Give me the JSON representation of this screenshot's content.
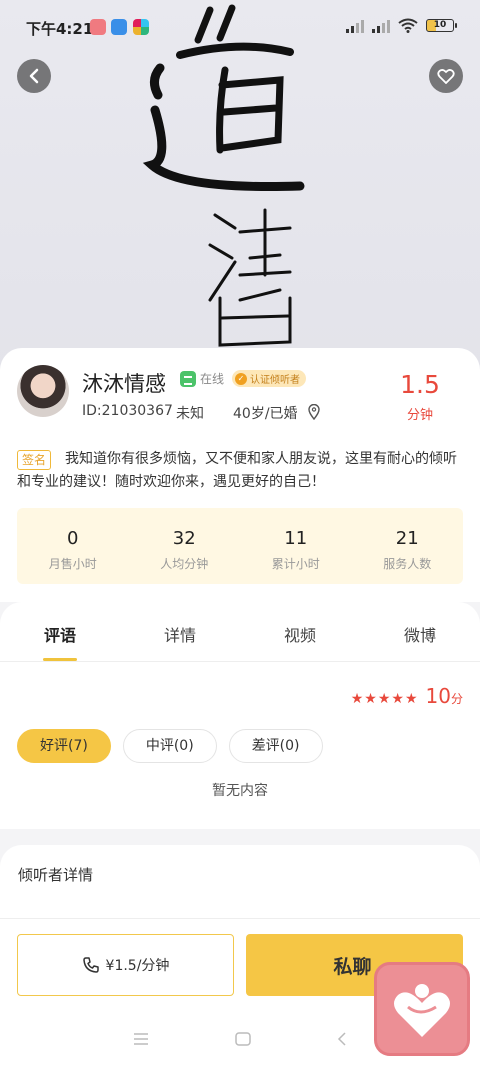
{
  "status_bar": {
    "time": "下午4:21",
    "battery": "10",
    "icons": [
      "heart-app-icon",
      "qq-icon",
      "slack-icon",
      "hd-signal-icon",
      "signal-icon",
      "wifi-icon",
      "battery-icon"
    ]
  },
  "hero": {
    "calligraphy_text": "道法自"
  },
  "profile": {
    "name": "沐沐情感",
    "online_label": "在线",
    "cert_label": "认证倾听者",
    "id": "ID:21030367",
    "gender": "未知",
    "age_marital": "40岁/已婚",
    "price": "1.5",
    "price_unit": "分钟",
    "sign_tag": "签名",
    "intro": "我知道你有很多烦恼，又不便和家人朋友说，这里有耐心的倾听和专业的建议！随时欢迎你来，遇见更好的自己！",
    "stats": [
      {
        "value": "0",
        "label": "月售小时"
      },
      {
        "value": "32",
        "label": "人均分钟"
      },
      {
        "value": "11",
        "label": "累计小时"
      },
      {
        "value": "21",
        "label": "服务人数"
      }
    ]
  },
  "tabs": [
    {
      "label": "评语",
      "active": true
    },
    {
      "label": "详情",
      "active": false
    },
    {
      "label": "视频",
      "active": false
    },
    {
      "label": "微博",
      "active": false
    }
  ],
  "reviews": {
    "stars": 5,
    "score": "10",
    "score_unit": "分",
    "filters": [
      {
        "label": "好评(7)",
        "selected": true
      },
      {
        "label": "中评(0)",
        "selected": false
      },
      {
        "label": "差评(0)",
        "selected": false
      }
    ],
    "empty_text": "暂无内容"
  },
  "details_section": {
    "heading": "倾听者详情"
  },
  "actions": {
    "call_label": "¥1.5/分钟",
    "chat_label": "私聊"
  },
  "colors": {
    "accent_yellow": "#f5c645",
    "price_red": "#e8493c",
    "online_green": "#4cc36a",
    "float_pink": "#ec8f95"
  }
}
